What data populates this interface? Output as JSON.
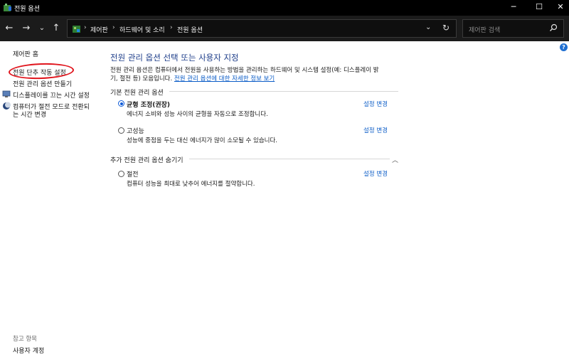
{
  "window": {
    "title": "전원 옵션",
    "controls": [
      "minimize-icon",
      "maximize-icon",
      "close-icon"
    ]
  },
  "address_bar": {
    "breadcrumbs": [
      "제어판",
      "하드웨어 및 소리",
      "전원 옵션"
    ],
    "search_placeholder": "제어판 검색"
  },
  "sidebar": {
    "items": [
      {
        "label": "제어판 홈",
        "icon": null
      },
      {
        "label": "전원 단추 작동 설정",
        "icon": null,
        "annotated": true
      },
      {
        "label": "전원 관리 옵션 만들기",
        "icon": null
      },
      {
        "label": "디스플레이를 끄는 시간 설정",
        "icon": "monitor-icon"
      },
      {
        "label": "컴퓨터가 절전 모드로 전환되",
        "label_line2": "는 시간 변경",
        "icon": "moon-icon"
      }
    ],
    "footer": {
      "heading": "참고 항목",
      "items": [
        {
          "label": "사용자 계정"
        }
      ]
    }
  },
  "main": {
    "title": "전원 관리 옵션 선택 또는 사용자 지정",
    "description_line1": "전원 관리 옵션은 컴퓨터에서 전원을 사용하는 방법을 관리하는 하드웨어 및 시스템 설정(예: 디스플레이 밝",
    "description_line2_prefix": "기, 절전 등) 모음입니다. ",
    "description_link": "전원 관리 옵션에 대한 자세한 정보 보기",
    "preferred_section": "기본 전원 관리 옵션",
    "additional_section": "추가 전원 관리 옵션 숨기기",
    "plans": [
      {
        "name": "균형 조정(권장)",
        "desc": "에너지 소비와 성능 사이의 균형을 자동으로 조정합니다.",
        "link": "설정 변경",
        "selected": true
      },
      {
        "name": "고성능",
        "desc": "성능에 중점을 두는 대신 에너지가 많이 소모될 수 있습니다.",
        "link": "설정 변경",
        "selected": false
      },
      {
        "name": "절전",
        "desc": "컴퓨터 성능을 최대로 낮추어 에너지를 절약합니다.",
        "link": "설정 변경",
        "selected": false
      }
    ]
  },
  "colors": {
    "title_blue": "#1e3e8a",
    "link_blue": "#0b5cc7",
    "annotation_red": "#e0141c",
    "chrome_dark": "#1b1b1b"
  }
}
